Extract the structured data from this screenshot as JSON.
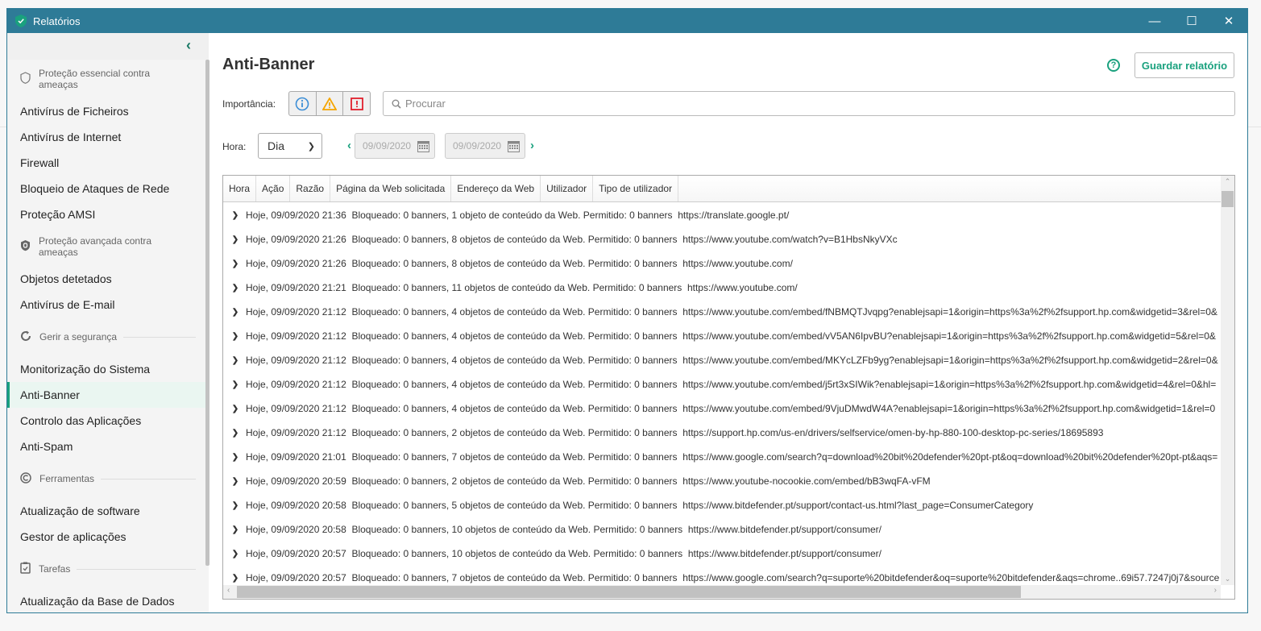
{
  "window": {
    "title": "Relatórios",
    "icon": "shield-check-icon",
    "controls": [
      "minimize-icon",
      "maximize-icon",
      "close-icon"
    ]
  },
  "accent": "#1aa17e",
  "titlebar_color": "#2e7b97",
  "sidebar": {
    "groups": [
      {
        "title": "Proteção essencial contra ameaças",
        "icon": "shield-outline-icon",
        "items": [
          "Antivírus de Ficheiros",
          "Antivírus de Internet",
          "Firewall",
          "Bloqueio de Ataques de Rede",
          "Proteção AMSI"
        ]
      },
      {
        "title": "Proteção avançada contra ameaças",
        "icon": "shield-filled-icon",
        "items": [
          "Objetos detetados",
          "Antivírus de E-mail"
        ]
      },
      {
        "title": "Gerir a segurança",
        "icon": "refresh-shield-icon",
        "items": [
          "Monitorização do Sistema",
          "Anti-Banner",
          "Controlo das Aplicações",
          "Anti-Spam"
        ]
      },
      {
        "title": "Ferramentas",
        "icon": "tools-icon",
        "items": [
          "Atualização de software",
          "Gestor de aplicações"
        ]
      },
      {
        "title": "Tarefas",
        "icon": "clipboard-check-icon",
        "items": [
          "Atualização da Base de Dados"
        ]
      }
    ],
    "active": "Anti-Banner"
  },
  "main": {
    "title": "Anti-Banner",
    "save_label": "Guardar relatório",
    "importance_label": "Importância:",
    "search_placeholder": "Procurar",
    "time_label": "Hora:",
    "period": "Dia",
    "date_from": "09/09/2020",
    "date_to": "09/09/2020",
    "columns": [
      "Hora",
      "Ação",
      "Razão",
      "Página da Web solicitada",
      "Endereço da Web",
      "Utilizador",
      "Tipo de utilizador"
    ],
    "rows": [
      {
        "time": "Hoje, 09/09/2020 21:36",
        "summary": "Bloqueado: 0 banners, 1 objeto de conteúdo da Web. Permitido: 0 banners",
        "url": "https://translate.google.pt/"
      },
      {
        "time": "Hoje, 09/09/2020 21:26",
        "summary": "Bloqueado: 0 banners, 8 objetos de conteúdo da Web. Permitido: 0 banners",
        "url": "https://www.youtube.com/watch?v=B1HbsNkyVXc"
      },
      {
        "time": "Hoje, 09/09/2020 21:26",
        "summary": "Bloqueado: 0 banners, 8 objetos de conteúdo da Web. Permitido: 0 banners",
        "url": "https://www.youtube.com/"
      },
      {
        "time": "Hoje, 09/09/2020 21:21",
        "summary": "Bloqueado: 0 banners, 11 objetos de conteúdo da Web. Permitido: 0 banners",
        "url": "https://www.youtube.com/"
      },
      {
        "time": "Hoje, 09/09/2020 21:12",
        "summary": "Bloqueado: 0 banners, 4 objetos de conteúdo da Web. Permitido: 0 banners",
        "url": "https://www.youtube.com/embed/fNBMQTJvqpg?enablejsapi=1&origin=https%3a%2f%2fsupport.hp.com&widgetid=3&rel=0&"
      },
      {
        "time": "Hoje, 09/09/2020 21:12",
        "summary": "Bloqueado: 0 banners, 4 objetos de conteúdo da Web. Permitido: 0 banners",
        "url": "https://www.youtube.com/embed/vV5AN6IpvBU?enablejsapi=1&origin=https%3a%2f%2fsupport.hp.com&widgetid=5&rel=0&"
      },
      {
        "time": "Hoje, 09/09/2020 21:12",
        "summary": "Bloqueado: 0 banners, 4 objetos de conteúdo da Web. Permitido: 0 banners",
        "url": "https://www.youtube.com/embed/MKYcLZFb9yg?enablejsapi=1&origin=https%3a%2f%2fsupport.hp.com&widgetid=2&rel=0&"
      },
      {
        "time": "Hoje, 09/09/2020 21:12",
        "summary": "Bloqueado: 0 banners, 4 objetos de conteúdo da Web. Permitido: 0 banners",
        "url": "https://www.youtube.com/embed/j5rt3xSIWik?enablejsapi=1&origin=https%3a%2f%2fsupport.hp.com&widgetid=4&rel=0&hl="
      },
      {
        "time": "Hoje, 09/09/2020 21:12",
        "summary": "Bloqueado: 0 banners, 4 objetos de conteúdo da Web. Permitido: 0 banners",
        "url": "https://www.youtube.com/embed/9VjuDMwdW4A?enablejsapi=1&origin=https%3a%2f%2fsupport.hp.com&widgetid=1&rel=0"
      },
      {
        "time": "Hoje, 09/09/2020 21:12",
        "summary": "Bloqueado: 0 banners, 2 objetos de conteúdo da Web. Permitido: 0 banners",
        "url": "https://support.hp.com/us-en/drivers/selfservice/omen-by-hp-880-100-desktop-pc-series/18695893"
      },
      {
        "time": "Hoje, 09/09/2020 21:01",
        "summary": "Bloqueado: 0 banners, 7 objetos de conteúdo da Web. Permitido: 0 banners",
        "url": "https://www.google.com/search?q=download%20bit%20defender%20pt-pt&oq=download%20bit%20defender%20pt-pt&aqs="
      },
      {
        "time": "Hoje, 09/09/2020 20:59",
        "summary": "Bloqueado: 0 banners, 2 objetos de conteúdo da Web. Permitido: 0 banners",
        "url": "https://www.youtube-nocookie.com/embed/bB3wqFA-vFM"
      },
      {
        "time": "Hoje, 09/09/2020 20:58",
        "summary": "Bloqueado: 0 banners, 5 objetos de conteúdo da Web. Permitido: 0 banners",
        "url": "https://www.bitdefender.pt/support/contact-us.html?last_page=ConsumerCategory"
      },
      {
        "time": "Hoje, 09/09/2020 20:58",
        "summary": "Bloqueado: 0 banners, 10 objetos de conteúdo da Web. Permitido: 0 banners",
        "url": "https://www.bitdefender.pt/support/consumer/"
      },
      {
        "time": "Hoje, 09/09/2020 20:57",
        "summary": "Bloqueado: 0 banners, 10 objetos de conteúdo da Web. Permitido: 0 banners",
        "url": "https://www.bitdefender.pt/support/consumer/"
      },
      {
        "time": "Hoje, 09/09/2020 20:57",
        "summary": "Bloqueado: 0 banners, 7 objetos de conteúdo da Web. Permitido: 0 banners",
        "url": "https://www.google.com/search?q=suporte%20bitdefender&oq=suporte%20bitdefender&aqs=chrome..69i57.7247j0j7&source"
      }
    ]
  }
}
